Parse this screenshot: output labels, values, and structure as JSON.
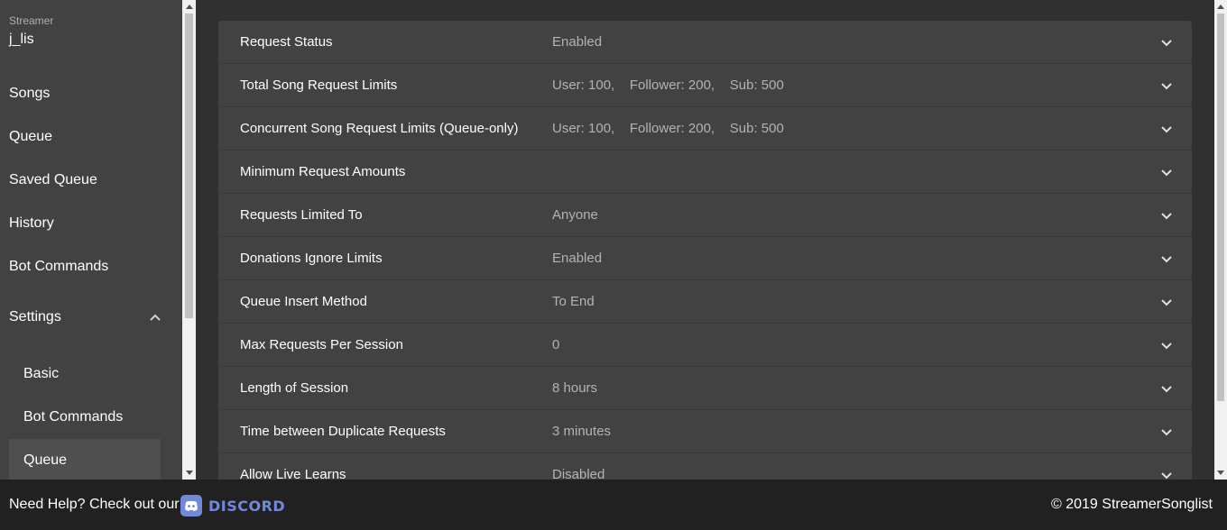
{
  "sidebar": {
    "streamer_label": "Streamer",
    "streamer_name": "j_lis",
    "items": [
      {
        "label": "Songs"
      },
      {
        "label": "Queue"
      },
      {
        "label": "Saved Queue"
      },
      {
        "label": "History"
      },
      {
        "label": "Bot Commands"
      },
      {
        "label": "Settings"
      }
    ],
    "settings_sub": [
      {
        "label": "Basic"
      },
      {
        "label": "Bot Commands"
      },
      {
        "label": "Queue"
      }
    ]
  },
  "settings": {
    "rows": [
      {
        "label": "Request Status",
        "value": "Enabled"
      },
      {
        "label": "Total Song Request Limits",
        "value": "User: 100,    Follower: 200,    Sub: 500"
      },
      {
        "label": "Concurrent Song Request Limits (Queue-only)",
        "value": "User: 100,    Follower: 200,    Sub: 500"
      },
      {
        "label": "Minimum Request Amounts",
        "value": ""
      },
      {
        "label": "Requests Limited To",
        "value": "Anyone"
      },
      {
        "label": "Donations Ignore Limits",
        "value": "Enabled"
      },
      {
        "label": "Queue Insert Method",
        "value": "To End"
      },
      {
        "label": "Max Requests Per Session",
        "value": "0"
      },
      {
        "label": "Length of Session",
        "value": "8 hours"
      },
      {
        "label": "Time between Duplicate Requests",
        "value": "3 minutes"
      },
      {
        "label": "Allow Live Learns",
        "value": "Disabled"
      }
    ]
  },
  "footer": {
    "help_text": "Need Help? Check out our",
    "discord_label": "DISCORD",
    "copyright": "© 2019 StreamerSonglist"
  },
  "colors": {
    "sidebar_bg": "#424242",
    "main_bg": "#303030",
    "panel_bg": "#424242",
    "footer_bg": "#212121",
    "discord": "#7289da",
    "value_text": "#b3b3b3"
  }
}
